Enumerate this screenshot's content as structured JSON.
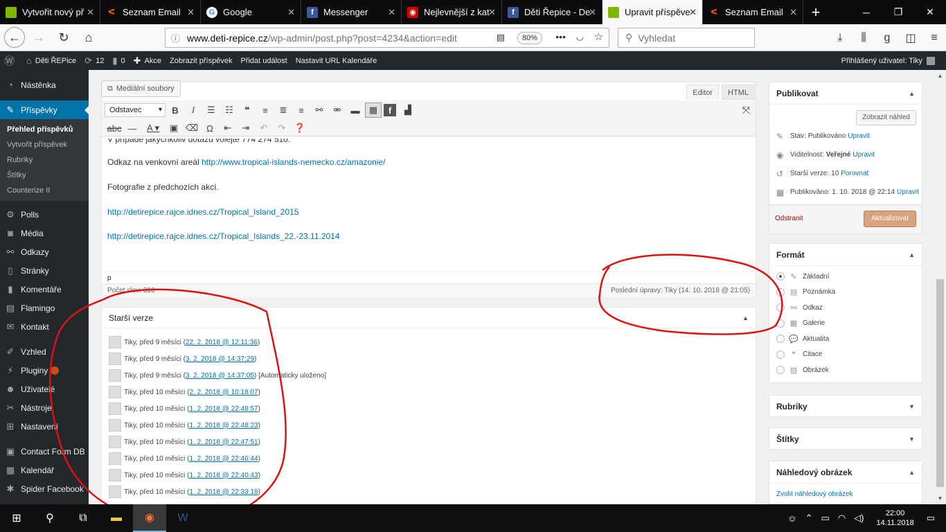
{
  "browser": {
    "tabs": [
      {
        "label": "Vytvořit nový př",
        "favicon": "leaf-favicon",
        "color": "#7fb800"
      },
      {
        "label": "Seznam Email",
        "favicon": "seznam-favicon",
        "color": "#cc0000"
      },
      {
        "label": "Google",
        "favicon": "google-favicon",
        "color": "#4285f4"
      },
      {
        "label": "Messenger",
        "favicon": "facebook-favicon",
        "color": "#3b5998"
      },
      {
        "label": "Nejlevnější z kat",
        "favicon": "shop-favicon",
        "color": "#d00000"
      },
      {
        "label": "Děti Řepice - De",
        "favicon": "facebook-favicon",
        "color": "#3b5998"
      },
      {
        "label": "Upravit příspěvek",
        "favicon": "leaf-favicon",
        "color": "#7fb800"
      },
      {
        "label": "Seznam Email",
        "favicon": "seznam-favicon",
        "color": "#cc0000"
      }
    ],
    "url_host": "www.deti-repice.cz",
    "url_path": "/wp-admin/post.php?post=4234&action=edit",
    "zoom": "80%",
    "search_placeholder": "Vyhledat"
  },
  "adminbar": {
    "site": "Děti ŘEPice",
    "updates": "12",
    "comments": "0",
    "new": "Akce",
    "view": "Zobrazit příspěvek",
    "add_event": "Přidat událost",
    "calendar": "Nastavit URL Kalendáře",
    "user": "Přihlášený uživatel: Tiky"
  },
  "menu": {
    "dashboard": "Nástěnka",
    "posts": "Příspěvky",
    "sub": [
      "Přehled příspěvků",
      "Vytvořit příspěvek",
      "Rubriky",
      "Štítky",
      "Counterize II"
    ],
    "items": [
      "Polls",
      "Média",
      "Odkazy",
      "Stránky",
      "Komentáře",
      "Flamingo",
      "Kontakt"
    ],
    "items2": [
      "Vzhled",
      "Pluginy",
      "Uživatelé",
      "Nástroje",
      "Nastavení"
    ],
    "items3": [
      "Contact Form DB",
      "Kalendář",
      "Spider Facebook"
    ]
  },
  "editor": {
    "media_button": "Mediální soubory",
    "tab_editor": "Editor",
    "tab_html": "HTML",
    "format_select": "Odstavec",
    "cut_line": "V případě jakýchkoliv dotazů volejte 774 274 510.",
    "p1_text": "Odkaz na venkovní areál ",
    "p1_link": "http://www.tropical-islands-nemecko.cz/amazonie/",
    "p2_text": "Fotografie z předchozích akcí.",
    "link1": "http://detirepice.rajce.idnes.cz/Tropical_Island_2015",
    "link2": "http://detirepice.rajce.idnes.cz/Tropical_Islands_22.-23.11.2014",
    "path": "p",
    "word_count": "Počet slov: 310",
    "last_edit": "Poslední úpravy: Tiky (14. 10. 2018 @ 21:05)"
  },
  "revisions": {
    "title": "Starší verze",
    "items": [
      {
        "text": "Tiky, před 9 měsíci (",
        "date": "22. 2. 2018 @ 12:11:36",
        "suffix": ")"
      },
      {
        "text": "Tiky, před 9 měsíci (",
        "date": "3. 2. 2018 @ 14:37:29",
        "suffix": ")"
      },
      {
        "text": "Tiky, před 9 měsíci (",
        "date": "3. 2. 2018 @ 14:37:05",
        "suffix": ") [Automaticky uloženo]"
      },
      {
        "text": "Tiky, před 10 měsíci (",
        "date": "2. 2. 2018 @ 10:18:07",
        "suffix": ")"
      },
      {
        "text": "Tiky, před 10 měsíci (",
        "date": "1. 2. 2018 @ 22:48:57",
        "suffix": ")"
      },
      {
        "text": "Tiky, před 10 měsíci (",
        "date": "1. 2. 2018 @ 22:48:23",
        "suffix": ")"
      },
      {
        "text": "Tiky, před 10 měsíci (",
        "date": "1. 2. 2018 @ 22:47:51",
        "suffix": ")"
      },
      {
        "text": "Tiky, před 10 měsíci (",
        "date": "1. 2. 2018 @ 22:46:44",
        "suffix": ")"
      },
      {
        "text": "Tiky, před 10 měsíci (",
        "date": "1. 2. 2018 @ 22:40:43",
        "suffix": ")"
      },
      {
        "text": "Tiky, před 10 měsíci (",
        "date": "1. 2. 2018 @ 22:33:18",
        "suffix": ")"
      }
    ]
  },
  "publish": {
    "title": "Publikovat",
    "preview": "Zobrazit náhled",
    "status_label": "Stav:",
    "status": "Publikováno",
    "visibility_label": "Viditelnost:",
    "visibility": "Veřejné",
    "revisions_label": "Starší verze:",
    "revisions_count": "10",
    "compare": "Porovnat",
    "published_label": "Publikováno:",
    "published": "1. 10. 2018 @ 22:14",
    "edit": "Upravit",
    "delete": "Odstranit",
    "update": "Aktualizovat"
  },
  "format": {
    "title": "Formát",
    "options": [
      "Základní",
      "Poznámka",
      "Odkaz",
      "Galerie",
      "Aktualita",
      "Citace",
      "Obrázek"
    ]
  },
  "categories": {
    "title": "Rubriky"
  },
  "tags": {
    "title": "Štítky"
  },
  "featured": {
    "title": "Náhledový obrázek",
    "link": "Zvolit náhledový obrázek"
  },
  "taskbar": {
    "time": "22:00",
    "date": "14.11.2018"
  },
  "colors": {
    "wp_blue": "#0073aa",
    "annotation_red": "#e01010",
    "update_btn": "#d6a37c"
  }
}
